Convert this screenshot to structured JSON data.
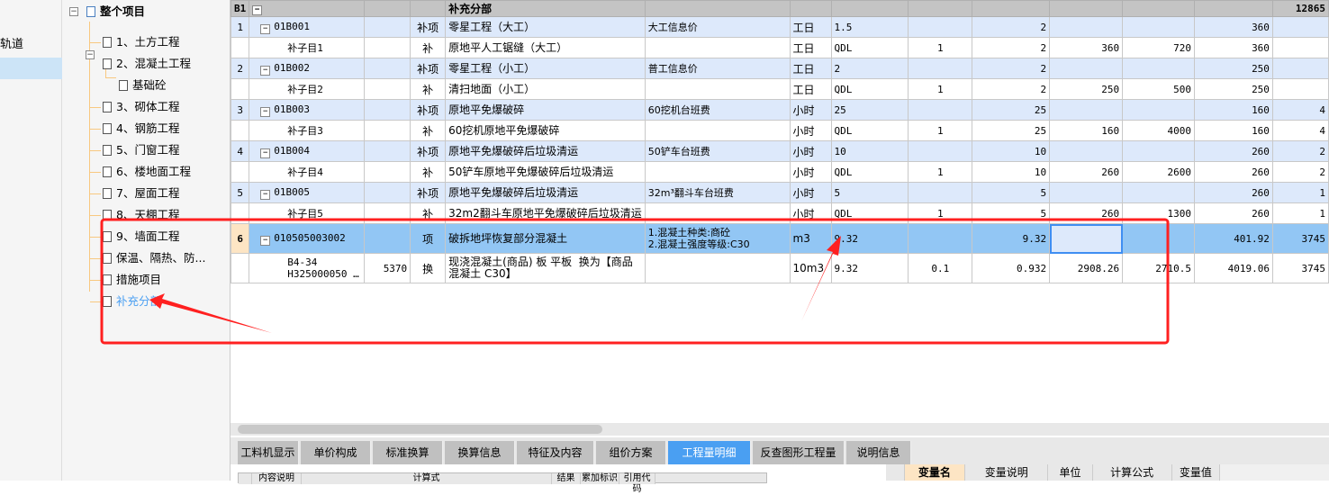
{
  "nav": {
    "items": [
      {
        "label": "轨道"
      },
      {
        "label": ""
      }
    ]
  },
  "tree": {
    "root": "整个项目",
    "items": [
      "1、土方工程",
      "2、混凝土工程",
      "基础砼",
      "3、砌体工程",
      "4、钢筋工程",
      "5、门窗工程",
      "6、楼地面工程",
      "7、屋面工程",
      "8、天棚工程",
      "9、墙面工程",
      "保温、隔热、防...",
      "措施项目",
      "补充分部"
    ],
    "selected": "补充分部",
    "selected_color": "#4a9ff2"
  },
  "grid": {
    "header": {
      "no": "B1",
      "name": "补充分部",
      "total": "12865"
    },
    "rows": [
      {
        "type": "parent",
        "no": "1",
        "code": "01B001",
        "x": "",
        "cat": "补项",
        "name": "零星工程（大工）",
        "feat": "大工信息价",
        "unit": "工日",
        "expr": "1.5",
        "qty_ratio": "",
        "qty": "2",
        "price": "",
        "amount": "",
        "unit_price": "360",
        "total": ""
      },
      {
        "type": "child",
        "no": "",
        "code": "补子目1",
        "x": "",
        "cat": "补",
        "name": "原地平人工锯缝（大工）",
        "feat": "",
        "unit": "工日",
        "expr": "QDL",
        "qty_ratio": "1",
        "qty": "2",
        "price": "360",
        "amount": "720",
        "unit_price": "360",
        "total": ""
      },
      {
        "type": "parent",
        "no": "2",
        "code": "01B002",
        "x": "",
        "cat": "补项",
        "name": "零星工程（小工）",
        "feat": "普工信息价",
        "unit": "工日",
        "expr": "2",
        "qty_ratio": "",
        "qty": "2",
        "price": "",
        "amount": "",
        "unit_price": "250",
        "total": ""
      },
      {
        "type": "child",
        "no": "",
        "code": "补子目2",
        "x": "",
        "cat": "补",
        "name": "清扫地面（小工）",
        "feat": "",
        "unit": "工日",
        "expr": "QDL",
        "qty_ratio": "1",
        "qty": "2",
        "price": "250",
        "amount": "500",
        "unit_price": "250",
        "total": ""
      },
      {
        "type": "parent",
        "no": "3",
        "code": "01B003",
        "x": "",
        "cat": "补项",
        "name": "原地平免爆破碎",
        "feat": "60挖机台班费",
        "unit": "小时",
        "expr": "25",
        "qty_ratio": "",
        "qty": "25",
        "price": "",
        "amount": "",
        "unit_price": "160",
        "total": "4"
      },
      {
        "type": "child",
        "no": "",
        "code": "补子目3",
        "x": "",
        "cat": "补",
        "name": "60挖机原地平免爆破碎",
        "feat": "",
        "unit": "小时",
        "expr": "QDL",
        "qty_ratio": "1",
        "qty": "25",
        "price": "160",
        "amount": "4000",
        "unit_price": "160",
        "total": "4"
      },
      {
        "type": "parent",
        "no": "4",
        "code": "01B004",
        "x": "",
        "cat": "补项",
        "name": "原地平免爆破碎后垃圾清运",
        "feat": "50铲车台班费",
        "unit": "小时",
        "expr": "10",
        "qty_ratio": "",
        "qty": "10",
        "price": "",
        "amount": "",
        "unit_price": "260",
        "total": "2"
      },
      {
        "type": "child",
        "no": "",
        "code": "补子目4",
        "x": "",
        "cat": "补",
        "name": "50铲车原地平免爆破碎后垃圾清运",
        "feat": "",
        "unit": "小时",
        "expr": "QDL",
        "qty_ratio": "1",
        "qty": "10",
        "price": "260",
        "amount": "2600",
        "unit_price": "260",
        "total": "2"
      },
      {
        "type": "parent",
        "no": "5",
        "code": "01B005",
        "x": "",
        "cat": "补项",
        "name": "原地平免爆破碎后垃圾清运",
        "feat": "32m³翻斗车台班费",
        "unit": "小时",
        "expr": "5",
        "qty_ratio": "",
        "qty": "5",
        "price": "",
        "amount": "",
        "unit_price": "260",
        "total": "1"
      },
      {
        "type": "child",
        "no": "",
        "code": "补子目5",
        "x": "",
        "cat": "补",
        "name": "32m2翻斗车原地平免爆破碎后垃圾清运",
        "feat": "",
        "unit": "小时",
        "expr": "QDL",
        "qty_ratio": "1",
        "qty": "5",
        "price": "260",
        "amount": "1300",
        "unit_price": "260",
        "total": "1"
      },
      {
        "type": "selected",
        "no": "6",
        "code": "010505003002",
        "x": "",
        "cat": "项",
        "name": "破拆地坪恢复部分混凝土",
        "feat": "1.混凝土种类:商砼\n2.混凝土强度等级:C30",
        "unit": "m3",
        "expr": "9.32",
        "qty_ratio": "",
        "qty": "9.32",
        "price": "",
        "amount": "",
        "unit_price": "401.92",
        "total": "3745"
      },
      {
        "type": "child2",
        "no": "",
        "code": "B4-34\nH325000050 …",
        "x": "5370",
        "cat": "换",
        "name": "现浇混凝土(商品) 板 平板  换为【商品混凝土 C30】",
        "feat": "",
        "unit": "10m3",
        "expr": "9.32",
        "qty_ratio": "0.1",
        "qty": "0.932",
        "price": "2908.26",
        "amount": "2710.5",
        "unit_price": "4019.06",
        "total": "3745"
      }
    ]
  },
  "tabs": {
    "items": [
      "工料机显示",
      "单价构成",
      "标准换算",
      "换算信息",
      "特征及内容",
      "组价方案",
      "工程量明细",
      "反查图形工程量",
      "说明信息"
    ],
    "active": "工程量明细",
    "active_color": "#4a9ff2"
  },
  "bottom_left": {
    "headers": [
      "",
      "内容说明",
      "计算式",
      "结果",
      "累加标识",
      "引用代码"
    ]
  },
  "bottom_right": {
    "headers": [
      "",
      "变量名",
      "变量说明",
      "单位",
      "计算公式",
      "变量值"
    ]
  },
  "annotation_color": "#ff2020"
}
